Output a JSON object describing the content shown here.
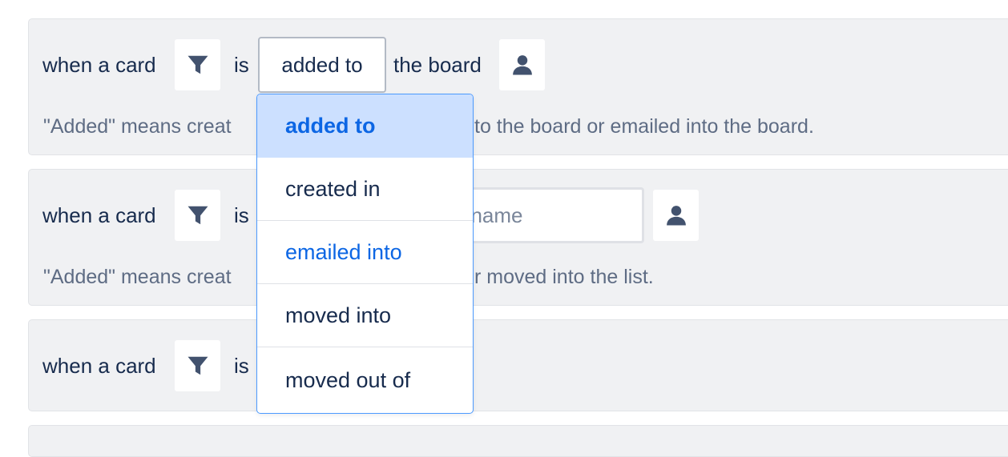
{
  "rules": [
    {
      "prefix": "when a card",
      "is_label": "is",
      "select_value": "added to",
      "suffix": "the board",
      "description": "\"Added\" means creat",
      "description_tail": "to the board or emailed into the board."
    },
    {
      "prefix": "when a card",
      "is_label": "is",
      "list_input_placeholder": "t name",
      "description": "\"Added\" means creat",
      "description_tail": "r moved into the list."
    },
    {
      "prefix": "when a card",
      "is_label": "is"
    }
  ],
  "dropdown": {
    "options": [
      {
        "label": "added to",
        "state": "selected"
      },
      {
        "label": "created in",
        "state": "normal"
      },
      {
        "label": "emailed into",
        "state": "highlighted"
      },
      {
        "label": "moved into",
        "state": "normal"
      },
      {
        "label": "moved out of",
        "state": "normal"
      }
    ]
  },
  "icons": {
    "filter": "filter-icon",
    "user": "user-icon"
  },
  "colors": {
    "panel_bg": "#f0f1f3",
    "text": "#172b4d",
    "muted_text": "#5e6c84",
    "accent": "#0c66e4",
    "selected_bg": "#cce0ff",
    "dropdown_border": "#4c9aff"
  }
}
